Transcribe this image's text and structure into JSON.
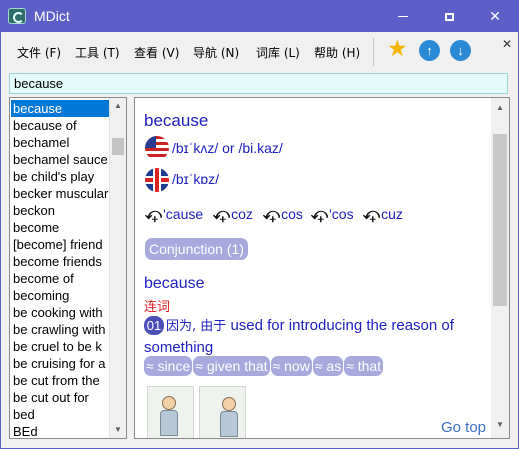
{
  "window": {
    "title": "MDict"
  },
  "menubar": {
    "items": [
      "文件 (F)",
      "工具 (T)",
      "查看 (V)",
      "导航 (N)",
      "词库 (L)",
      "帮助 (H)"
    ],
    "close_glyph": "✕",
    "toolbar_icons": [
      "star-icon",
      "back-arrow-icon",
      "forward-arrow-icon"
    ]
  },
  "search": {
    "value": "because"
  },
  "word_list": {
    "selected": "because",
    "items": [
      "because",
      "because of",
      "bechamel",
      "bechamel sauce",
      "be child's play",
      "becker muscular",
      "beckon",
      "become",
      "[become] friend",
      "become friends",
      "become of",
      "becoming",
      "be cooking with",
      "be crawling with",
      "be cruel to be k",
      "be cruising for a",
      "be cut from the",
      "be cut out for",
      "bed",
      "BEd"
    ]
  },
  "entry": {
    "headword": "because",
    "pron_us": "/bɪˈkʌz/ or /bi.kaz/",
    "pron_uk": "/bɪˈkɒz/",
    "variants": [
      "'cause",
      "coz",
      "cos",
      "'cos",
      "cuz"
    ],
    "pos_tag": "Conjunction (1)",
    "sense_headword": "because",
    "pos_cn": "连词",
    "sense_number": "01",
    "definition_cn": "因为, 由于",
    "definition_en": "used for introducing the reason of something",
    "synonyms": [
      "≈ since",
      "≈ given that",
      "≈ now",
      "≈ as",
      "≈ that"
    ],
    "go_top": "Go top"
  },
  "colors": {
    "titlebar": "#5b5fc7",
    "selection": "#0078d7",
    "entry_text": "#2020c0",
    "tag_bg": "#a8a9dd"
  }
}
